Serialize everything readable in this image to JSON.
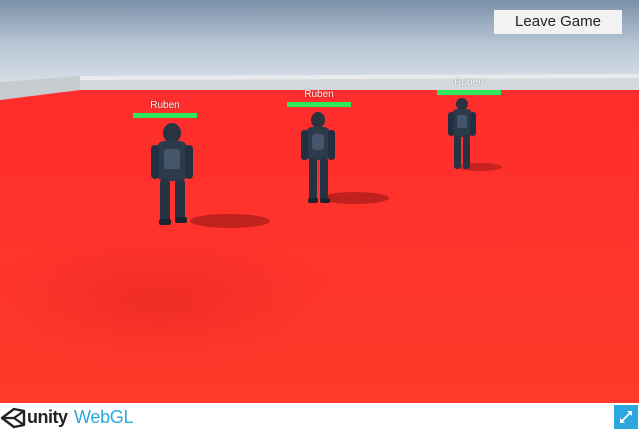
{
  "hud": {
    "leave_label": "Leave Game"
  },
  "players": [
    {
      "name": "Ruben",
      "health": 1.0
    },
    {
      "name": "Ruben",
      "health": 1.0
    },
    {
      "name": "Ruben",
      "health": 1.0
    }
  ],
  "footer": {
    "brand": "unity",
    "platform": "WebGL"
  },
  "colors": {
    "floor": "#ff2a2a",
    "health": "#2ee85a",
    "accent": "#2ca7e0"
  },
  "icons": {
    "fullscreen": "fullscreen-icon",
    "logo": "unity-logo-icon"
  }
}
